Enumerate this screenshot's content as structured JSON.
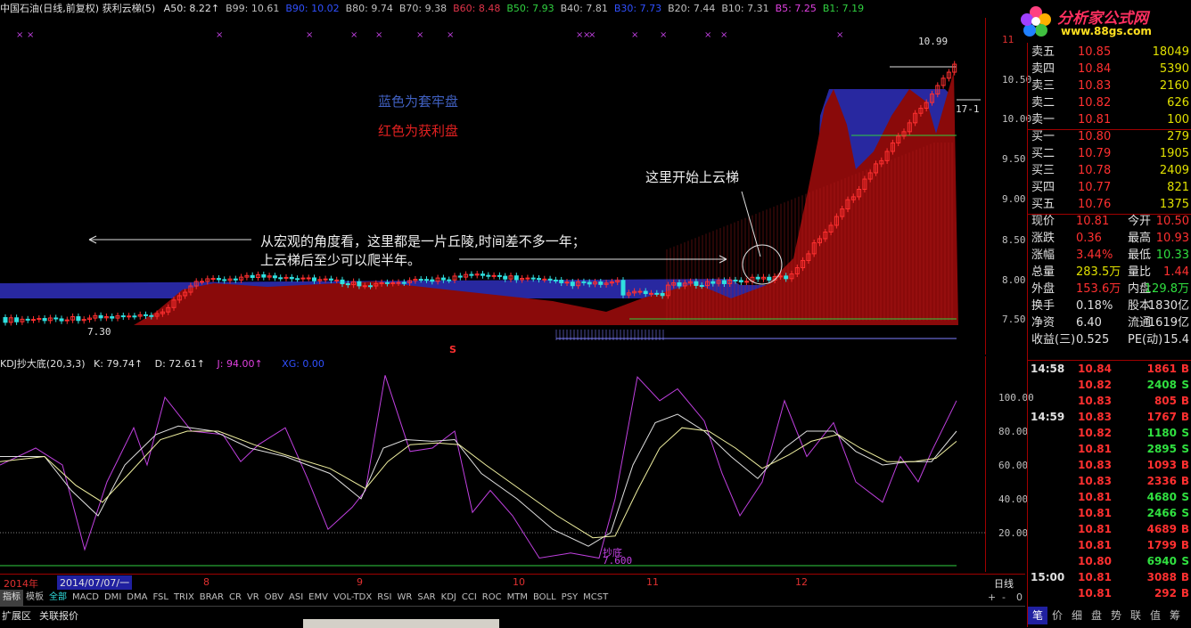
{
  "header": {
    "title": "中国石油(日线,前复权) 获利云梯(5)",
    "items": [
      {
        "text": "A50: 8.22↑",
        "color": "#e0e0e0"
      },
      {
        "text": "B99: 10.61",
        "color": "#c0c0c0"
      },
      {
        "text": "B90: 10.02",
        "color": "#3050ff"
      },
      {
        "text": "B80: 9.74",
        "color": "#c0c0c0"
      },
      {
        "text": "B70: 9.38",
        "color": "#c0c0c0"
      },
      {
        "text": "B60: 8.48",
        "color": "#e0344a"
      },
      {
        "text": "B50: 7.93",
        "color": "#30d040"
      },
      {
        "text": "B40: 7.81",
        "color": "#c0c0c0"
      },
      {
        "text": "B30: 7.73",
        "color": "#3050ff"
      },
      {
        "text": "B20: 7.44",
        "color": "#c0c0c0"
      },
      {
        "text": "B10: 7.31",
        "color": "#c0c0c0"
      },
      {
        "text": "B5: 7.25",
        "color": "#e040e0"
      },
      {
        "text": "B1: 7.19",
        "color": "#30d040"
      }
    ]
  },
  "logo": {
    "text": "分析家公式网",
    "url_text": "www.88gs.com"
  },
  "annotations": {
    "blue_note": "蓝色为套牢盘",
    "red_note": "红色为获利盘",
    "ladder_note": "这里开始上云梯",
    "macro_note_1": "从宏观的角度看，这里都是一片丘陵,时间差不多一年；",
    "macro_note_2": "上云梯后至少可以爬半年。",
    "low_label": "7.30",
    "high_label": "10.99",
    "right_mark": "17-1",
    "s_mark": "S"
  },
  "price_axis": [
    "11",
    "10.50",
    "10.00",
    "9.50",
    "9.00",
    "8.50",
    "8.00",
    "7.50"
  ],
  "kdj": {
    "title": "KDJ抄大底(20,3,3)",
    "k": "K: 79.74↑",
    "d": "D: 72.61↑",
    "j": "J: 94.00↑",
    "xg": "XG: 0.00",
    "signal_label": "抄底",
    "signal_value": "7.600",
    "axis": [
      "100.00",
      "80.00",
      "60.00",
      "40.00",
      "20.00"
    ]
  },
  "date_axis": {
    "year": "2014年",
    "current_date": "2014/07/07/一",
    "months": [
      "8",
      "9",
      "10",
      "11",
      "12"
    ],
    "period": "日线"
  },
  "indicator_bar": {
    "labels": [
      "指标",
      "模板",
      "全部",
      "MACD",
      "DMI",
      "DMA",
      "FSL",
      "TRIX",
      "BRAR",
      "CR",
      "VR",
      "OBV",
      "ASI",
      "EMV",
      "VOL-TDX",
      "RSI",
      "WR",
      "SAR",
      "KDJ",
      "CCI",
      "ROC",
      "MTM",
      "BOLL",
      "PSY",
      "MCST"
    ],
    "right": [
      "+",
      "-",
      "0"
    ]
  },
  "bottom_bar": {
    "items": [
      "扩展区",
      "关联报价"
    ]
  },
  "order_book": {
    "sell": [
      {
        "label": "卖五",
        "price": "10.85",
        "vol": "18049"
      },
      {
        "label": "卖四",
        "price": "10.84",
        "vol": "5390"
      },
      {
        "label": "卖三",
        "price": "10.83",
        "vol": "2160"
      },
      {
        "label": "卖二",
        "price": "10.82",
        "vol": "626"
      },
      {
        "label": "卖一",
        "price": "10.81",
        "vol": "100"
      }
    ],
    "buy": [
      {
        "label": "买一",
        "price": "10.80",
        "vol": "279"
      },
      {
        "label": "买二",
        "price": "10.79",
        "vol": "1905"
      },
      {
        "label": "买三",
        "price": "10.78",
        "vol": "2409"
      },
      {
        "label": "买四",
        "price": "10.77",
        "vol": "821"
      },
      {
        "label": "买五",
        "price": "10.76",
        "vol": "1375"
      }
    ]
  },
  "quote": [
    {
      "l1": "现价",
      "v1": "10.81",
      "c1": "#ff3030",
      "l2": "今开",
      "v2": "10.50",
      "c2": "#ff3030"
    },
    {
      "l1": "涨跌",
      "v1": "0.36",
      "c1": "#ff3030",
      "l2": "最高",
      "v2": "10.93",
      "c2": "#ff3030"
    },
    {
      "l1": "涨幅",
      "v1": "3.44%",
      "c1": "#ff3030",
      "l2": "最低",
      "v2": "10.33",
      "c2": "#30e040"
    },
    {
      "l1": "总量",
      "v1": "283.5万",
      "c1": "#e0e000",
      "l2": "量比",
      "v2": "1.44",
      "c2": "#ff3030"
    },
    {
      "l1": "外盘",
      "v1": "153.6万",
      "c1": "#ff3030",
      "l2": "内盘",
      "v2": "129.8万",
      "c2": "#30e040"
    },
    {
      "l1": "换手",
      "v1": "0.18%",
      "c1": "#e0e0e0",
      "l2": "股本",
      "v2": "1830亿",
      "c2": "#e0e0e0"
    },
    {
      "l1": "净资",
      "v1": "6.40",
      "c1": "#e0e0e0",
      "l2": "流通",
      "v2": "1619亿",
      "c2": "#e0e0e0"
    },
    {
      "l1": "收益(三)",
      "v1": "0.525",
      "c1": "#e0e0e0",
      "l2": "PE(动)",
      "v2": "15.4",
      "c2": "#e0e0e0"
    }
  ],
  "ticks": [
    {
      "time": "14:58",
      "price": "10.84",
      "vol": "1861",
      "side": "B"
    },
    {
      "time": "",
      "price": "10.82",
      "vol": "2408",
      "side": "S"
    },
    {
      "time": "",
      "price": "10.83",
      "vol": "805",
      "side": "B"
    },
    {
      "time": "14:59",
      "price": "10.83",
      "vol": "1767",
      "side": "B"
    },
    {
      "time": "",
      "price": "10.82",
      "vol": "1180",
      "side": "S"
    },
    {
      "time": "",
      "price": "10.81",
      "vol": "2895",
      "side": "S"
    },
    {
      "time": "",
      "price": "10.83",
      "vol": "1093",
      "side": "B"
    },
    {
      "time": "",
      "price": "10.83",
      "vol": "2336",
      "side": "B"
    },
    {
      "time": "",
      "price": "10.81",
      "vol": "4680",
      "side": "S"
    },
    {
      "time": "",
      "price": "10.81",
      "vol": "2466",
      "side": "S"
    },
    {
      "time": "",
      "price": "10.81",
      "vol": "4689",
      "side": "B"
    },
    {
      "time": "",
      "price": "10.81",
      "vol": "1799",
      "side": "B"
    },
    {
      "time": "",
      "price": "10.80",
      "vol": "6940",
      "side": "S"
    },
    {
      "time": "15:00",
      "price": "10.81",
      "vol": "3088",
      "side": "B"
    },
    {
      "time": "",
      "price": "10.81",
      "vol": "292",
      "side": "B"
    }
  ],
  "right_tabs": [
    "笔",
    "价",
    "细",
    "盘",
    "势",
    "联",
    "值",
    "筹"
  ],
  "colors": {
    "up": "#ff3030",
    "down": "#30e0e0",
    "blue_zone": "#2828a0",
    "red_zone": "#8a0a0a",
    "green": "#30d040",
    "magenta": "#c040e0"
  }
}
